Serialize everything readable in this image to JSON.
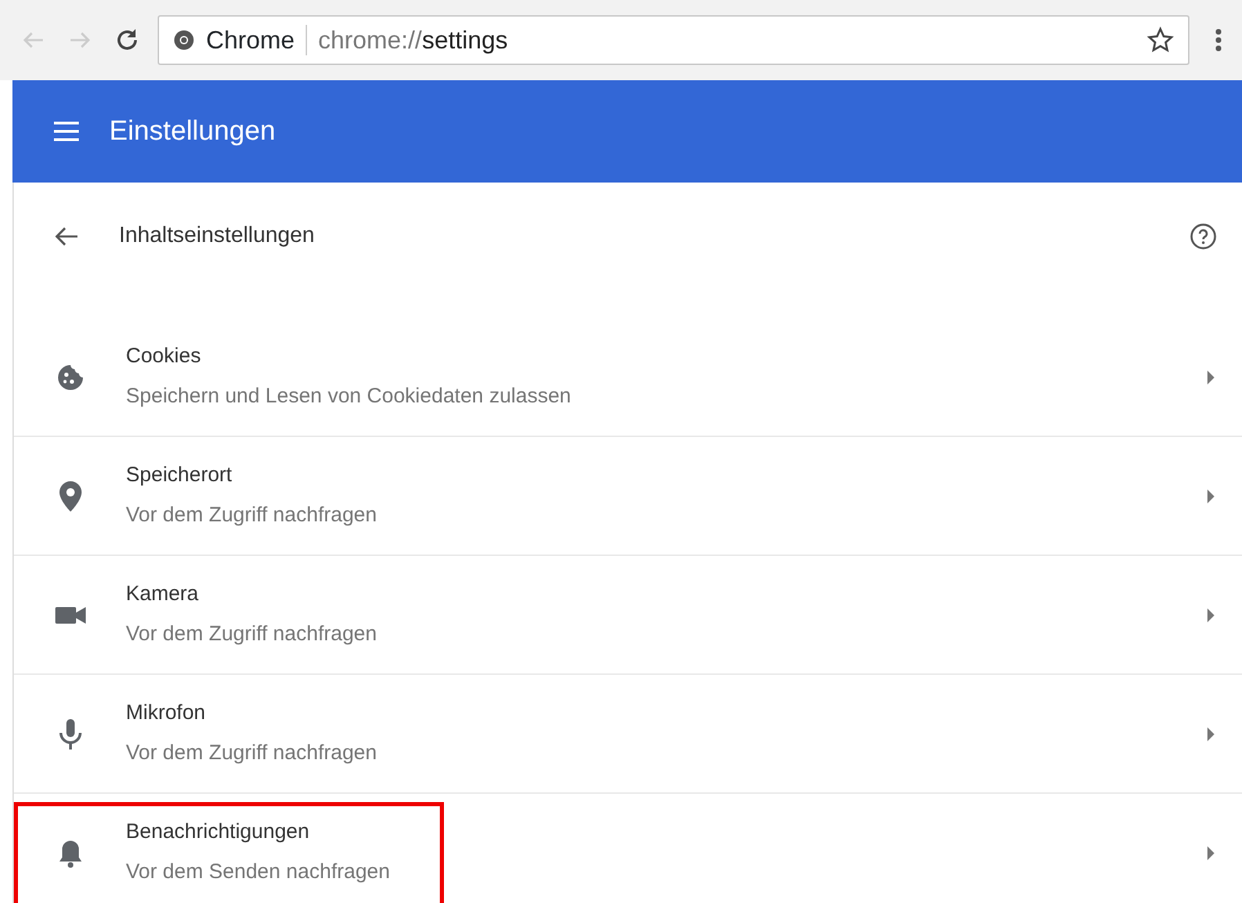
{
  "browser": {
    "site_label": "Chrome",
    "url_scheme": "chrome://",
    "url_rest": "settings"
  },
  "header": {
    "title": "Einstellungen"
  },
  "subpage": {
    "title": "Inhaltseinstellungen"
  },
  "items": [
    {
      "kind": "cookie",
      "title": "Cookies",
      "subtitle": "Speichern und Lesen von Cookiedaten zulassen",
      "highlighted": false
    },
    {
      "kind": "location",
      "title": "Speicherort",
      "subtitle": "Vor dem Zugriff nachfragen",
      "highlighted": false
    },
    {
      "kind": "camera",
      "title": "Kamera",
      "subtitle": "Vor dem Zugriff nachfragen",
      "highlighted": false
    },
    {
      "kind": "microphone",
      "title": "Mikrofon",
      "subtitle": "Vor dem Zugriff nachfragen",
      "highlighted": false
    },
    {
      "kind": "bell",
      "title": "Benachrichtigungen",
      "subtitle": "Vor dem Senden nachfragen",
      "highlighted": true
    }
  ]
}
